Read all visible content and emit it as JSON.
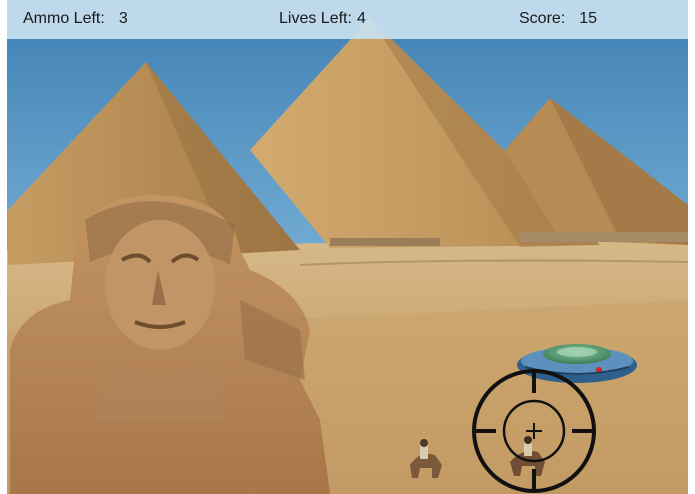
{
  "hud": {
    "ammo": {
      "label": "Ammo Left:",
      "value": "3"
    },
    "lives": {
      "label": "Lives Left:",
      "value": "4"
    },
    "score": {
      "label": "Score:",
      "value": "15"
    }
  },
  "scene": {
    "background": "giza-pyramids-and-sphinx",
    "sky_color": "#6aa6cf",
    "sand_color": "#c9a46c",
    "pyramid_color": "#b98e56"
  },
  "targets": [
    {
      "type": "ufo",
      "icon": "flying-saucer-icon",
      "colors": [
        "#3d6e9c",
        "#4f8f57",
        "#d42020"
      ]
    }
  ],
  "cursor": {
    "icon": "crosshair-icon",
    "color": "#111111"
  }
}
